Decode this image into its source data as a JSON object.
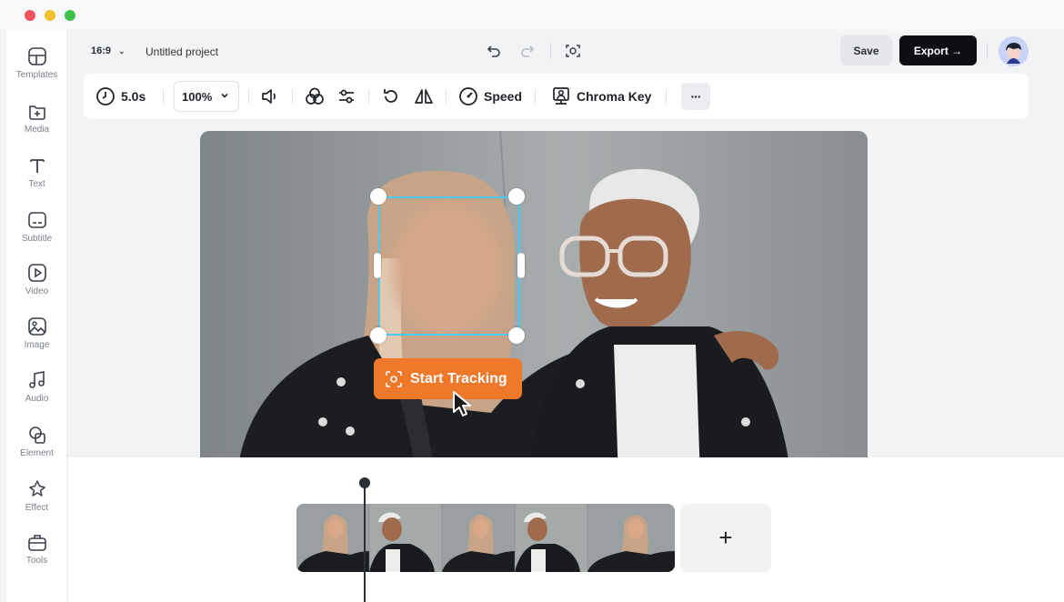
{
  "window": {
    "controls": [
      "close",
      "minimize",
      "maximize"
    ]
  },
  "sidebar": {
    "items": [
      {
        "label": "Templates",
        "icon": "templates-icon"
      },
      {
        "label": "Media",
        "icon": "media-icon"
      },
      {
        "label": "Text",
        "icon": "text-icon"
      },
      {
        "label": "Subtitle",
        "icon": "subtitle-icon"
      },
      {
        "label": "Video",
        "icon": "video-icon"
      },
      {
        "label": "Image",
        "icon": "image-icon"
      },
      {
        "label": "Audio",
        "icon": "audio-icon"
      },
      {
        "label": "Element",
        "icon": "element-icon"
      },
      {
        "label": "Effect",
        "icon": "effect-icon"
      },
      {
        "label": "Tools",
        "icon": "tools-icon"
      }
    ]
  },
  "topbar": {
    "aspect_ratio": "16:9",
    "project_name": "Untitled project",
    "save_label": "Save",
    "export_label": "Export →"
  },
  "toolbar": {
    "duration": "5.0s",
    "zoom": "100%",
    "speed_label": "Speed",
    "chroma_key_label": "Chroma Key",
    "more_label": "···"
  },
  "canvas": {
    "track_button_label": "Start Tracking"
  },
  "timeline": {
    "add_label": "+"
  },
  "colors": {
    "accent_orange": "#f0782a",
    "selection_cyan": "#4cc9f0",
    "export_bg": "#0d0f12"
  }
}
